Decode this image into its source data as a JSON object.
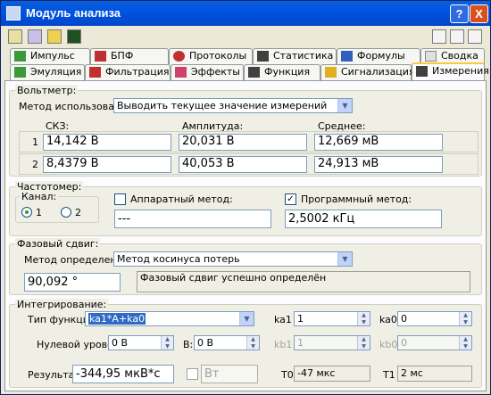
{
  "window": {
    "title": "Модуль анализа",
    "help": "?",
    "close": "X"
  },
  "toolbar": {
    "tools": [
      "tool-1",
      "tool-2",
      "tool-3",
      "tool-4"
    ]
  },
  "tabs_row1": [
    "Импульс",
    "БПФ",
    "Протоколы",
    "Статистика",
    "Формулы",
    "Сводка"
  ],
  "tabs_row2": [
    "Эмуляция",
    "Фильтрация",
    "Эффекты",
    "Функция",
    "Сигнализация",
    "Измерения"
  ],
  "voltmeter": {
    "legend": "Вольтметр:",
    "mode_label": "Метод использования:",
    "mode_value": "Выводить текущее значение измерений",
    "col_rms": "СКЗ:",
    "col_amp": "Амплитуда:",
    "col_avg": "Среднее:",
    "rows": [
      {
        "n": "1",
        "rms": "14,142 В",
        "amp": "20,031 В",
        "avg": "12,669 мВ"
      },
      {
        "n": "2",
        "rms": "8,4379 В",
        "amp": "40,053 В",
        "avg": "24,913 мВ"
      }
    ]
  },
  "freq": {
    "legend": "Частотомер:",
    "channel_label": "Канал:",
    "ch1": "1",
    "ch2": "2",
    "hw_label": "Аппаратный метод:",
    "hw_value": "---",
    "sw_label": "Программный метод:",
    "sw_value": "2,5002 кГц",
    "sw_check": "✓"
  },
  "phase": {
    "legend": "Фазовый сдвиг:",
    "method_label": "Метод определения:",
    "method_value": "Метод косинуса потерь",
    "value": "90,092 °",
    "status": "Фазовый сдвиг успешно определён"
  },
  "integr": {
    "legend": "Интегрирование:",
    "func_label": "Тип функции:",
    "func_value": "ka1*A+ka0",
    "ka1_label": "ka1",
    "ka1_value": "1",
    "ka0_label": "ka0",
    "ka0_value": "0",
    "zero_a_label": "Нулевой уровень А:",
    "zero_a_value": "0 В",
    "b_label": "В:",
    "b_value": "0 В",
    "kb1_label": "kb1",
    "kb1_value": "1",
    "kb0_label": "kb0",
    "kb0_value": "0",
    "result_label": "Результат:",
    "result_value": "-344,95 мкВ*с",
    "bt_label": "Вт",
    "t0_label": "T0",
    "t0_value": "-47 мкс",
    "t1_label": "T1",
    "t1_value": "2 мс"
  }
}
